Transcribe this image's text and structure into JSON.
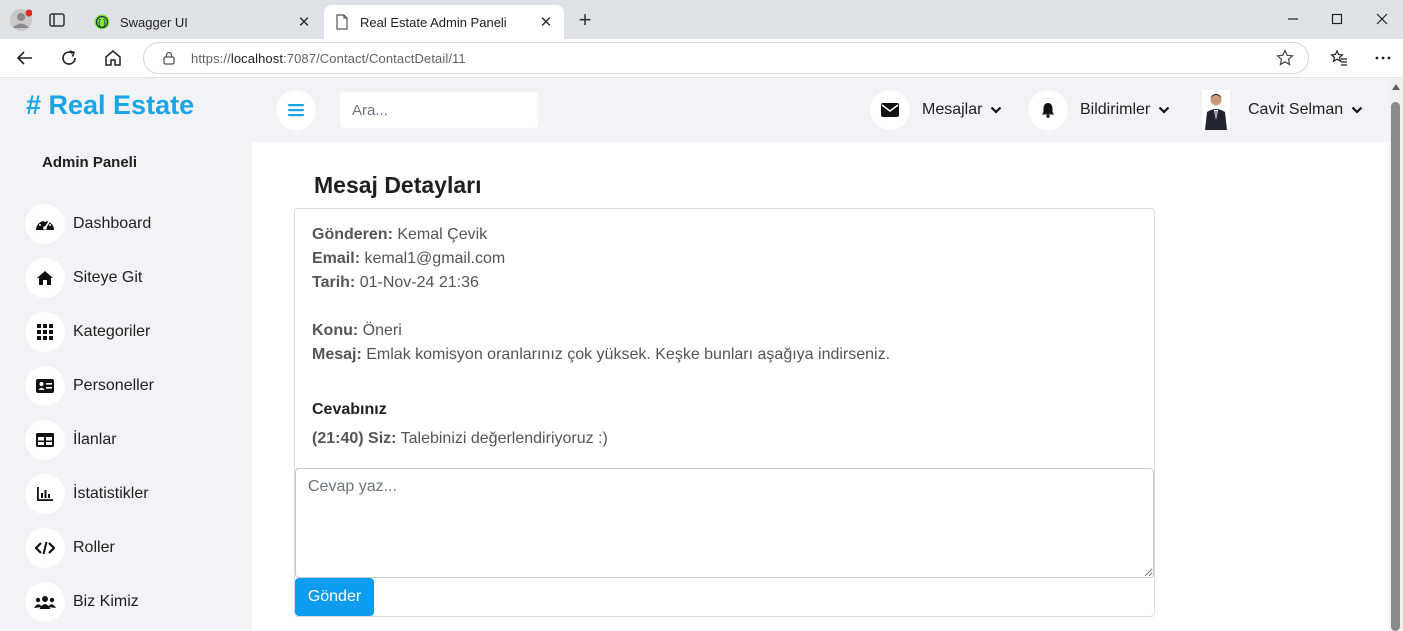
{
  "browser": {
    "tabs": [
      {
        "title": "Swagger UI",
        "active": false
      },
      {
        "title": "Real Estate Admin Paneli",
        "active": true
      }
    ],
    "url_prefix": "https://",
    "url_host": "localhost",
    "url_rest": ":7087/Contact/ContactDetail/11"
  },
  "sidebar": {
    "brand": "# Real Estate",
    "panel_title": "Admin Paneli",
    "items": [
      {
        "label": "Dashboard",
        "icon": "gauge-icon"
      },
      {
        "label": "Siteye Git",
        "icon": "home-icon"
      },
      {
        "label": "Kategoriler",
        "icon": "grid-icon"
      },
      {
        "label": "Personeller",
        "icon": "id-card-icon"
      },
      {
        "label": "İlanlar",
        "icon": "table-icon"
      },
      {
        "label": "İstatistikler",
        "icon": "bar-chart-icon"
      },
      {
        "label": "Roller",
        "icon": "code-icon"
      },
      {
        "label": "Biz Kimiz",
        "icon": "users-icon"
      }
    ]
  },
  "topbar": {
    "search_placeholder": "Ara...",
    "messages_label": "Mesajlar",
    "notifications_label": "Bildirimler",
    "user_name": "Cavit Selman"
  },
  "main": {
    "title": "Mesaj Detayları",
    "sender_label": "Gönderen:",
    "sender_value": "Kemal Çevik",
    "email_label": "Email:",
    "email_value": "kemal1@gmail.com",
    "date_label": "Tarih:",
    "date_value": "01-Nov-24 21:36",
    "subject_label": "Konu:",
    "subject_value": "Öneri",
    "message_label": "Mesaj:",
    "message_value": "Emlak komisyon oranlarınız çok yüksek. Keşke bunları aşağıya indirseniz.",
    "reply_heading": "Cevabınız",
    "reply_meta": "(21:40) Siz:",
    "reply_text": "Talebinizi değerlendiriyoruz :)",
    "reply_placeholder": "Cevap yaz...",
    "send_label": "Gönder"
  },
  "colors": {
    "brand": "#1ba5e6",
    "button": "#0d9cf0",
    "sidebar_bg": "#f2f3f6"
  }
}
